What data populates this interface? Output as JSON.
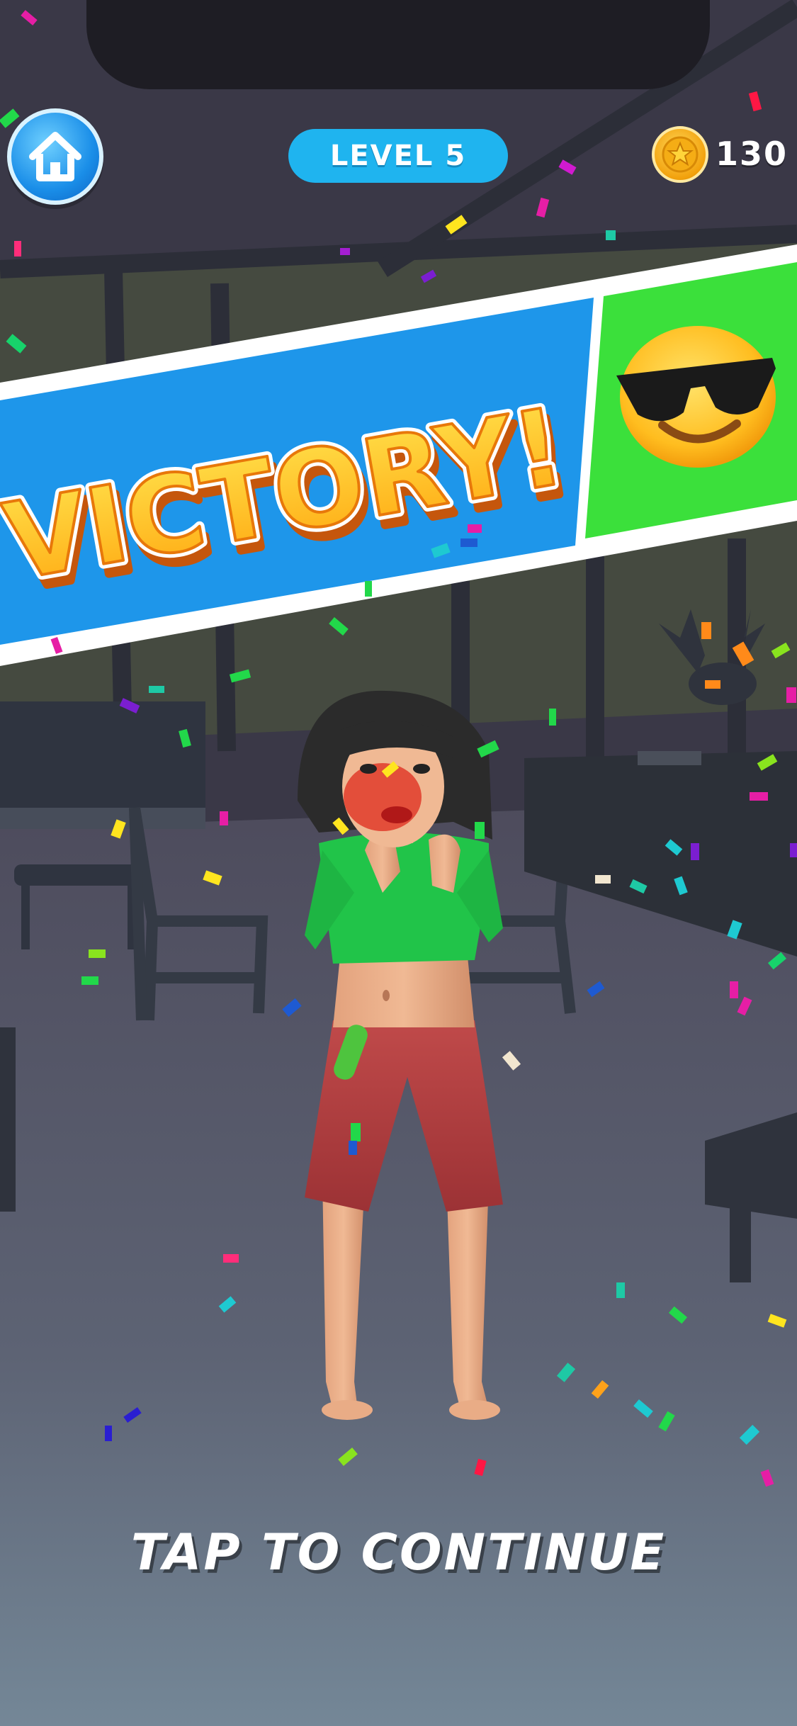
{
  "hud": {
    "home_icon": "home-icon",
    "level_label": "LEVEL 5",
    "coin_icon": "coin-star-icon",
    "coins": "130"
  },
  "banner": {
    "title": "VICTORY!",
    "emoji": "sunglasses-smiley-icon",
    "colors": {
      "panel": "#1e96ea",
      "emoji_panel": "#3be03b",
      "text_fill": "#ffc21a",
      "text_outline": "#e8780a"
    }
  },
  "footer": {
    "continue_label": "TAP TO CONTINUE"
  }
}
